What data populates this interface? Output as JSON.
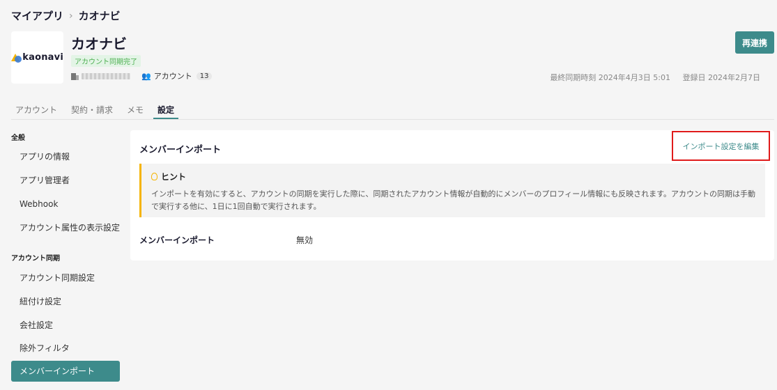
{
  "breadcrumb": {
    "parent": "マイアプリ",
    "separator": "›",
    "current": "カオナビ"
  },
  "app": {
    "logo_text": "kaonavi",
    "title": "カオナビ",
    "sync_status": "アカウント同期完了",
    "account_label": "アカウント",
    "account_count": "13",
    "relink_label": "再連携",
    "last_sync": "最終同期時刻 2024年4月3日 5:01",
    "registered": "登録日 2024年2月7日"
  },
  "tabs": [
    {
      "label": "アカウント",
      "active": false
    },
    {
      "label": "契約・請求",
      "active": false
    },
    {
      "label": "メモ",
      "active": false
    },
    {
      "label": "設定",
      "active": true
    }
  ],
  "sidebar": {
    "sections": [
      {
        "title": "全般",
        "items": [
          "アプリの情報",
          "アプリ管理者",
          "Webhook",
          "アカウント属性の表示設定"
        ]
      },
      {
        "title": "アカウント同期",
        "items": [
          "アカウント同期設定",
          "紐付け設定",
          "会社設定",
          "除外フィルタ",
          "メンバーインポート"
        ]
      }
    ],
    "active_item": "メンバーインポート"
  },
  "panel": {
    "title": "メンバーインポート",
    "edit_link": "インポート設定を編集",
    "hint_title": "ヒント",
    "hint_body": "インポートを有効にすると、アカウントの同期を実行した際に、同期されたアカウント情報が自動的にメンバーのプロフィール情報にも反映されます。アカウントの同期は手動で実行する他に、1日に1回自動で実行されます。",
    "field_label": "メンバーインポート",
    "field_value": "無効"
  },
  "colors": {
    "accent": "#3d8b8b",
    "badge_green": "#4caf50",
    "hint_border": "#f5b400",
    "highlight": "#e01b1b"
  },
  "icons": {
    "org": "building-icon",
    "accounts": "people-icon",
    "hint": "lightbulb-icon"
  }
}
